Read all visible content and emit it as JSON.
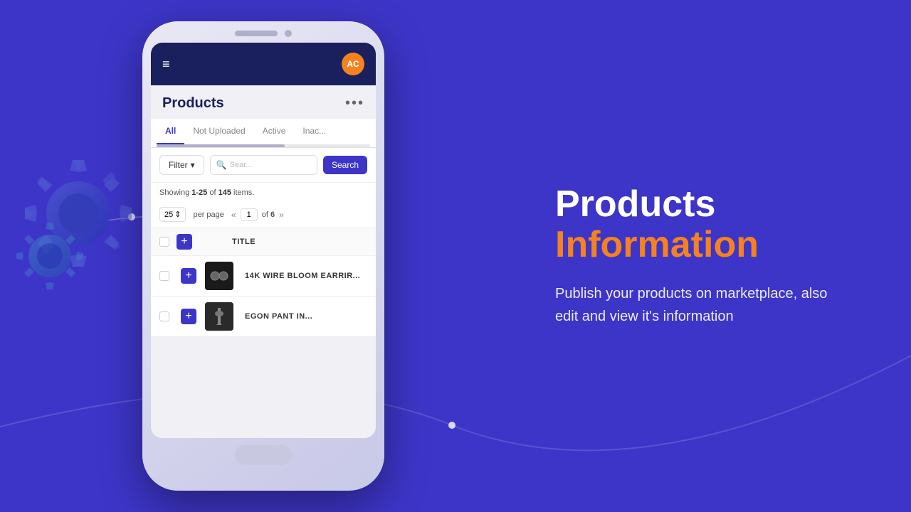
{
  "background": {
    "color": "#3d35c8"
  },
  "phone": {
    "header": {
      "avatar_initials": "AC",
      "avatar_bg": "#f5821f"
    },
    "products": {
      "title": "Products",
      "more_icon": "•••",
      "tabs": [
        {
          "label": "All",
          "active": true
        },
        {
          "label": "Not Uploaded",
          "active": false
        },
        {
          "label": "Active",
          "active": false
        },
        {
          "label": "Inac...",
          "active": false
        }
      ],
      "filter_btn": "Filter",
      "search_placeholder": "Sear...",
      "search_btn": "Search",
      "showing_text": "Showing",
      "showing_range": "1-25",
      "showing_of": "of",
      "showing_total": "145",
      "showing_items": "items.",
      "per_page": "25",
      "per_page_label": "per page",
      "current_page": "1",
      "total_pages": "6",
      "table_header": "TITLE",
      "products": [
        {
          "name": "14k Wire Bloom Earrir...",
          "thumb_color": "#222"
        },
        {
          "name": "Egon Pant in...",
          "thumb_color": "#333"
        }
      ]
    }
  },
  "right": {
    "heading_line1": "Products",
    "heading_line2": "Information",
    "description": "Publish your products on marketplace, also edit and view it's information"
  },
  "icons": {
    "hamburger": "≡",
    "more": "•••",
    "filter_arrow": "▾",
    "search": "🔍",
    "chevron_left": "«",
    "chevron_right": "»",
    "plus": "+",
    "stepper": "⇕"
  }
}
